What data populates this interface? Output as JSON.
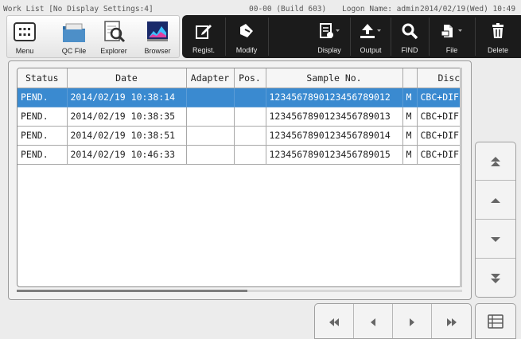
{
  "status_bar": {
    "title": "Work List [No Display Settings:4]",
    "build": "00-00 (Build 603)",
    "logon": "Logon Name: admin",
    "datetime": "2014/02/19(Wed) 10:49"
  },
  "toolbar": {
    "menu": "Menu",
    "qc_file": "QC File",
    "explorer": "Explorer",
    "browser": "Browser",
    "regist": "Regist.",
    "modify": "Modify",
    "display": "Display",
    "output": "Output",
    "find": "FIND",
    "file": "File",
    "delete": "Delete"
  },
  "table": {
    "columns": [
      "Status",
      "Date",
      "Adapter",
      "Pos.",
      "Sample No.",
      "",
      "Discre"
    ],
    "rows": [
      {
        "status": "PEND.",
        "date": "2014/02/19 10:38:14",
        "adapter": "",
        "pos": "",
        "sample_no": "123456789012345678901​2",
        "flag": "M",
        "discrete": "CBC+DIFF",
        "selected": true
      },
      {
        "status": "PEND.",
        "date": "2014/02/19 10:38:35",
        "adapter": "",
        "pos": "",
        "sample_no": "1234567890123456789013",
        "flag": "M",
        "discrete": "CBC+DIFF",
        "selected": false
      },
      {
        "status": "PEND.",
        "date": "2014/02/19 10:38:51",
        "adapter": "",
        "pos": "",
        "sample_no": "1234567890123456789014",
        "flag": "M",
        "discrete": "CBC+DIFF",
        "selected": false
      },
      {
        "status": "PEND.",
        "date": "2014/02/19 10:46:33",
        "adapter": "",
        "pos": "",
        "sample_no": "1234567890123456789015",
        "flag": "M",
        "discrete": "CBC+DIFF",
        "selected": false
      }
    ]
  },
  "colors": {
    "selection": "#3a8ad0",
    "toolbar_dark": "#1b1b1b"
  }
}
